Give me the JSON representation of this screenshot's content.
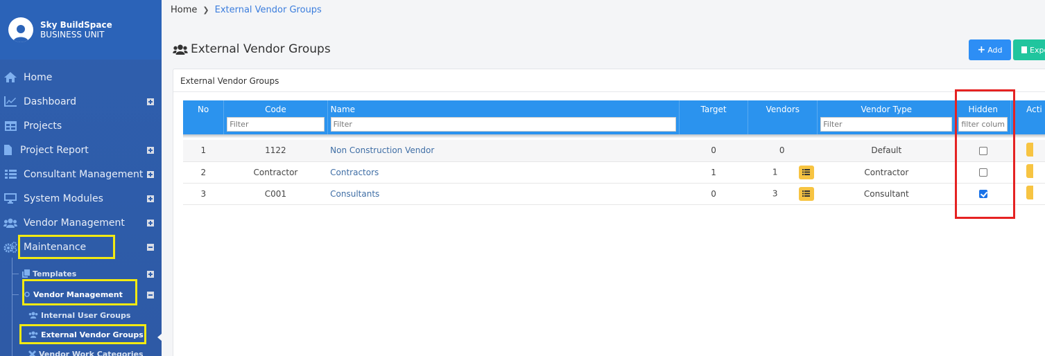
{
  "brand": {
    "name": "Sky BuildSpace",
    "unit": "BUSINESS UNIT"
  },
  "sidebar": {
    "items": [
      {
        "label": "Home",
        "icon": "home-icon",
        "expandable": false
      },
      {
        "label": "Dashboard",
        "icon": "chart-line-icon",
        "expandable": true
      },
      {
        "label": "Projects",
        "icon": "table-icon",
        "expandable": false
      },
      {
        "label": "Project Report",
        "icon": "file-icon",
        "expandable": true
      },
      {
        "label": "Consultant Management",
        "icon": "list-icon",
        "expandable": true
      },
      {
        "label": "System Modules",
        "icon": "desktop-icon",
        "expandable": true
      },
      {
        "label": "Vendor Management",
        "icon": "users-icon",
        "expandable": true
      },
      {
        "label": "Maintenance",
        "icon": "cogs-icon",
        "expandable": true,
        "expanded": true
      }
    ],
    "sub_items": {
      "templates": "Templates",
      "vendor_management": "Vendor Management",
      "internal_user_groups": "Internal User Groups",
      "external_vendor_groups": "External Vendor Groups",
      "vendor_work_categories": "Vendor Work Categories"
    }
  },
  "breadcrumb": {
    "home": "Home",
    "current": "External Vendor Groups"
  },
  "page": {
    "title": "External Vendor Groups"
  },
  "toolbar": {
    "add_label": "Add",
    "export_label": "Expo"
  },
  "card": {
    "title": "External Vendor Groups"
  },
  "table": {
    "columns": {
      "no": "No",
      "code": "Code",
      "name": "Name",
      "target": "Target",
      "vendors": "Vendors",
      "vendor_type": "Vendor Type",
      "hidden": "Hidden",
      "actions": "Acti"
    },
    "filters": {
      "code": "Filter",
      "name": "Filter",
      "vendor_type": "Filter",
      "hidden": "filter colum"
    },
    "rows": [
      {
        "no": "1",
        "code": "1122",
        "name": "Non Construction Vendor",
        "target": "0",
        "vendors": "0",
        "has_list": false,
        "vendor_type": "Default",
        "hidden": false
      },
      {
        "no": "2",
        "code": "Contractor",
        "name": "Contractors",
        "target": "1",
        "vendors": "1",
        "has_list": true,
        "vendor_type": "Contractor",
        "hidden": false
      },
      {
        "no": "3",
        "code": "C001",
        "name": "Consultants",
        "target": "0",
        "vendors": "3",
        "has_list": true,
        "vendor_type": "Consultant",
        "hidden": true
      }
    ]
  },
  "colors": {
    "sidebar_bg": "#2f5fae",
    "table_header": "#2b93ee",
    "add_button": "#2d8ef5",
    "export_button": "#20c59e",
    "highlight_yellow": "#f2ea12",
    "highlight_red": "#e52222",
    "list_button": "#f7c442",
    "link": "#3f6ea5"
  }
}
